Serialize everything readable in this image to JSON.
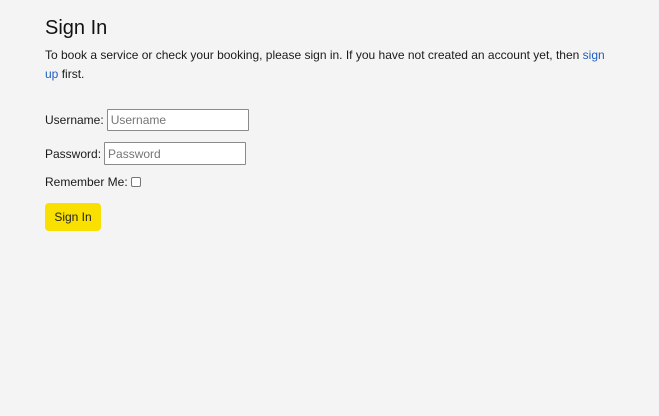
{
  "page": {
    "title": "Sign In",
    "intro_text_before_link": "To book a service or check your booking, please sign in. If you have not created an account yet, then ",
    "intro_link": "sign up",
    "intro_text_after_link": " first."
  },
  "form": {
    "username_label": "Username:",
    "username_placeholder": "Username",
    "username_value": "",
    "password_label": "Password:",
    "password_placeholder": "Password",
    "password_value": "",
    "remember_label": "Remember Me:",
    "remember_checked": false,
    "submit_label": "Sign In"
  },
  "colors": {
    "background": "#f4f4f4",
    "link": "#1f5fbf",
    "button": "#f9e000"
  }
}
